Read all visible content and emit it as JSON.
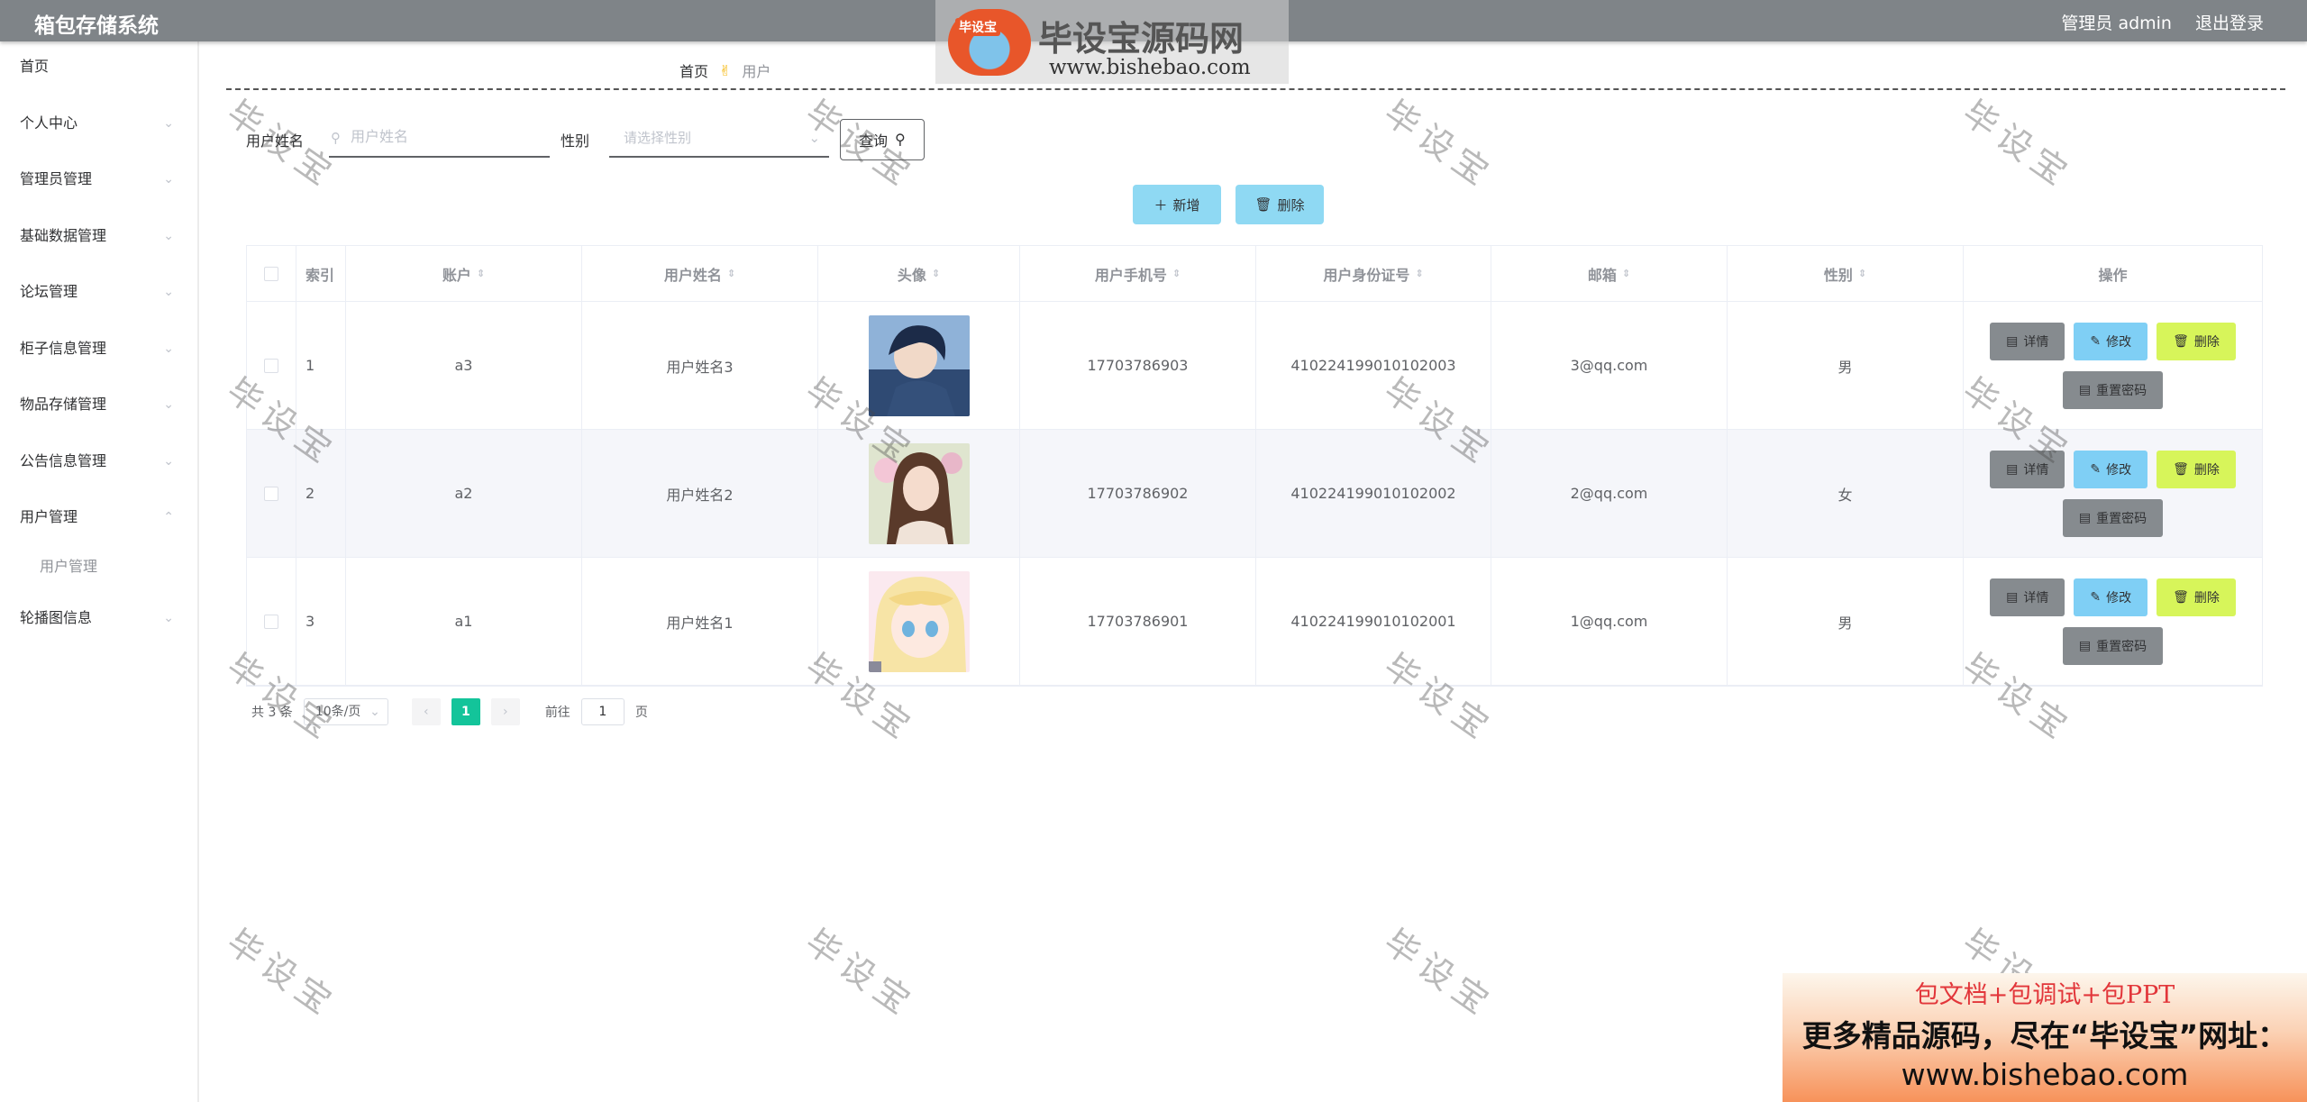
{
  "header": {
    "title": "箱包存储系统",
    "admin_label": "管理员 admin",
    "logout_label": "退出登录"
  },
  "sidebar": {
    "items": [
      {
        "label": "首页"
      },
      {
        "label": "个人中心"
      },
      {
        "label": "管理员管理"
      },
      {
        "label": "基础数据管理"
      },
      {
        "label": "论坛管理"
      },
      {
        "label": "柜子信息管理"
      },
      {
        "label": "物品存储管理"
      },
      {
        "label": "公告信息管理"
      },
      {
        "label": "用户管理"
      },
      {
        "label": "轮播图信息"
      }
    ],
    "sub_item": "用户管理"
  },
  "breadcrumb": {
    "home": "首页",
    "current": "用户"
  },
  "search": {
    "name_label": "用户姓名",
    "name_placeholder": "用户姓名",
    "sex_label": "性别",
    "sex_placeholder": "请选择性别",
    "query_label": "查询"
  },
  "actions": {
    "add_label": "新增",
    "delete_label": "删除"
  },
  "table": {
    "headers": {
      "index": "索引",
      "account": "账户",
      "name": "用户姓名",
      "avatar": "头像",
      "phone": "用户手机号",
      "id_card": "用户身份证号",
      "email": "邮箱",
      "sex": "性别",
      "ops": "操作"
    },
    "rows": [
      {
        "index": "1",
        "account": "a3",
        "name": "用户姓名3",
        "phone": "17703786903",
        "id_card": "410224199010102003",
        "email": "3@qq.com",
        "sex": "男"
      },
      {
        "index": "2",
        "account": "a2",
        "name": "用户姓名2",
        "phone": "17703786902",
        "id_card": "410224199010102002",
        "email": "2@qq.com",
        "sex": "女"
      },
      {
        "index": "3",
        "account": "a1",
        "name": "用户姓名1",
        "phone": "17703786901",
        "id_card": "410224199010102001",
        "email": "1@qq.com",
        "sex": "男"
      }
    ],
    "op_labels": {
      "detail": "详情",
      "edit": "修改",
      "delete": "删除",
      "reset": "重置密码"
    }
  },
  "pager": {
    "total": "共 3 条",
    "page_size": "10条/页",
    "current_page": "1",
    "goto_label": "前往",
    "goto_value": "1",
    "page_unit": "页"
  },
  "watermark": {
    "text": "毕设宝",
    "logo_title": "毕设宝源码网",
    "logo_badge": "毕设宝",
    "logo_url": "www.bishebao.com"
  },
  "promo": {
    "line1": "包文档+包调试+包PPT",
    "line2": "更多精品源码，尽在“毕设宝”网址：",
    "line3": "www.bishebao.com"
  },
  "colors": {
    "topbar": "#7f8488",
    "accent": "#13c49a",
    "add_button": "#8fd9f3",
    "edit_button": "#7fcff5",
    "delete_button": "#d7f55a",
    "detail_button": "#868b8f"
  }
}
